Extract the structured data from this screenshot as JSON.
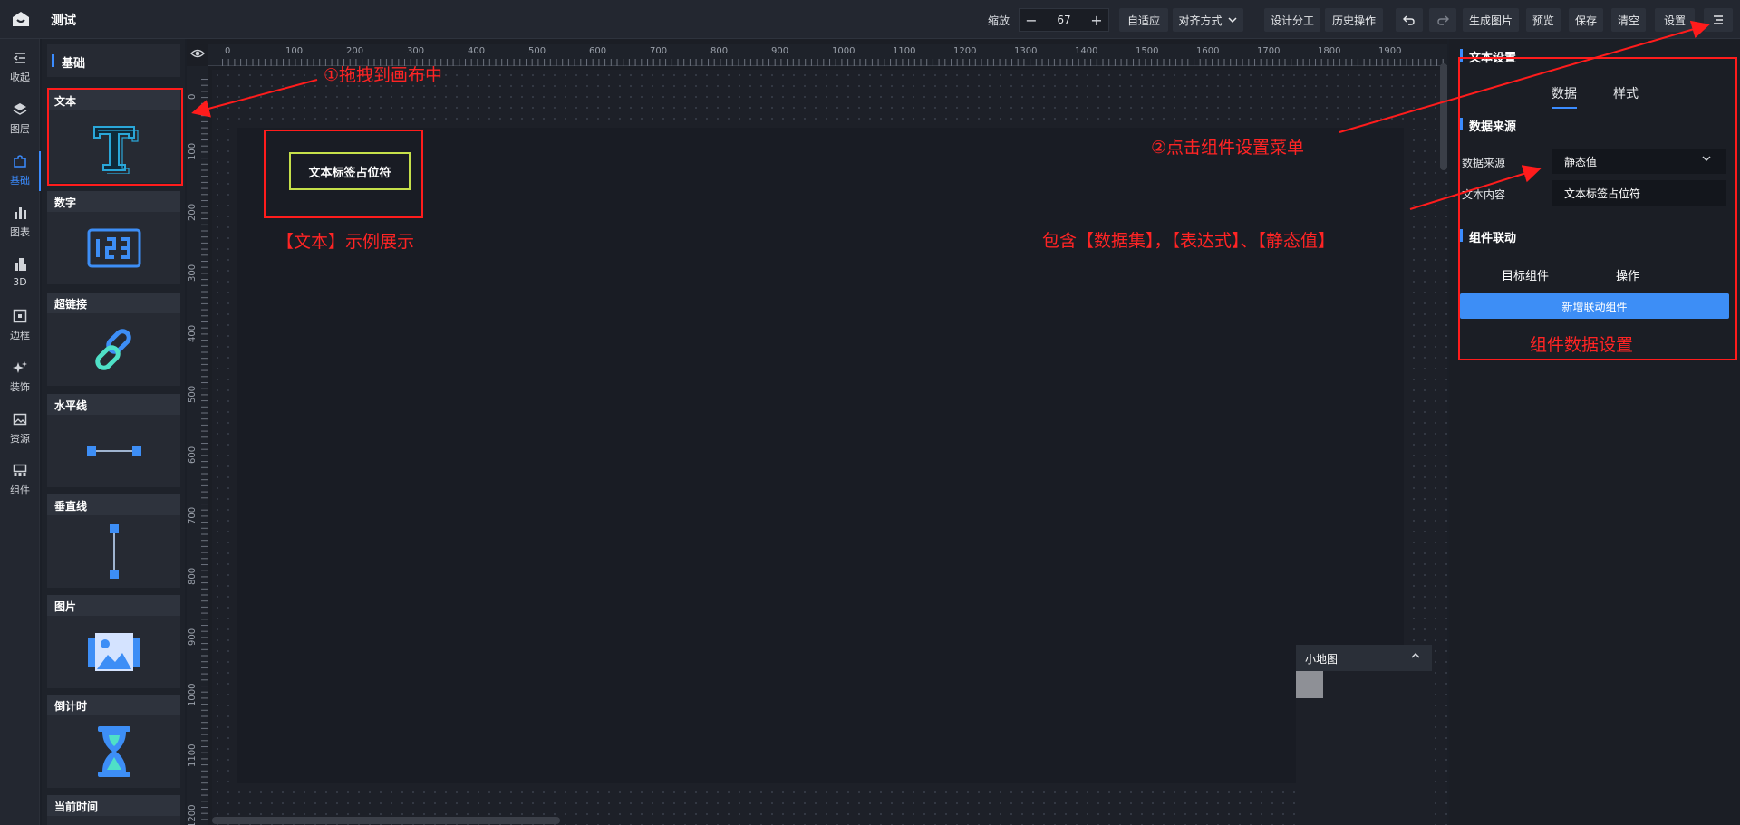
{
  "app": {
    "title": "测试"
  },
  "toolbar": {
    "zoom_label": "缩放",
    "zoom_value": "67",
    "zoom_minus": "−",
    "zoom_plus": "+",
    "buttons": [
      "自适应",
      "对齐方式",
      "设计分工",
      "历史操作",
      "生成图片",
      "预览",
      "保存",
      "清空",
      "设置"
    ]
  },
  "rail": {
    "items": [
      "收起",
      "图层",
      "基础",
      "图表",
      "3D",
      "边框",
      "装饰",
      "资源",
      "组件"
    ],
    "active": "基础"
  },
  "panel": {
    "title": "基础",
    "components": [
      "文本",
      "数字",
      "超链接",
      "水平线",
      "垂直线",
      "图片",
      "倒计时",
      "当前时间"
    ]
  },
  "ruler": {
    "top_ticks": [
      "0",
      "100",
      "200",
      "300",
      "400",
      "500",
      "600",
      "700",
      "800",
      "900",
      "1000",
      "1100",
      "1200",
      "1300",
      "1400",
      "1500",
      "1600",
      "1700",
      "1800",
      "1900"
    ],
    "left_ticks": [
      "0",
      "100",
      "200",
      "300",
      "400",
      "500",
      "600",
      "700",
      "800",
      "900",
      "1000",
      "1100",
      "1200"
    ]
  },
  "canvas": {
    "widget_text": "文本标签占位符"
  },
  "minimap": {
    "title": "小地图",
    "caret": "^"
  },
  "settings": {
    "title": "文本设置",
    "tabs": [
      "数据",
      "样式"
    ],
    "datasource_section": "数据来源",
    "datasource_label": "数据来源",
    "datasource_value": "静态值",
    "content_label": "文本内容",
    "content_value": "文本标签占位符",
    "linkage_section": "组件联动",
    "col_target": "目标组件",
    "col_action": "操作",
    "add_button": "新增联动组件"
  },
  "annotations": {
    "drag_hint": "①拖拽到画布中",
    "example_hint": "【文本】示例展示",
    "menu_hint": "②点击组件设置菜单",
    "source_hint": "包含【数据集】，【表达式】、【静态值】",
    "data_hint": "组件数据设置"
  },
  "colors": {
    "accent": "#3b8cff",
    "annotation": "#ff1c1c",
    "widget_border": "#c6e04a"
  }
}
